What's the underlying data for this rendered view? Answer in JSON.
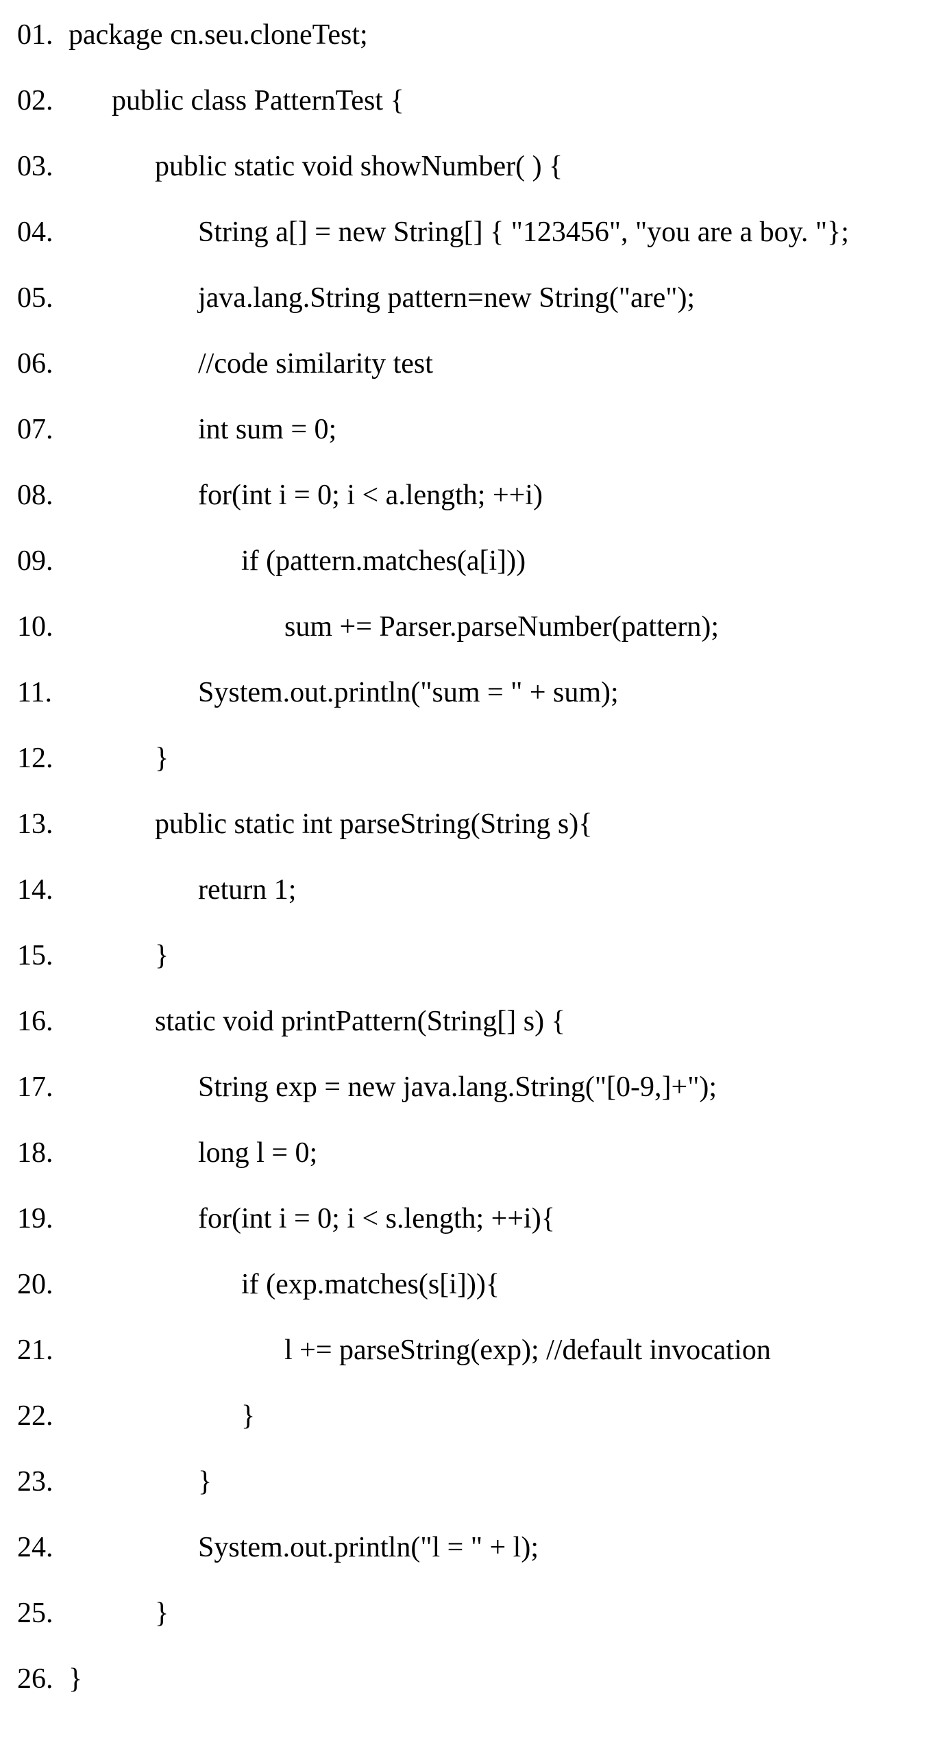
{
  "code": {
    "lines": [
      {
        "num": "01.",
        "indent": 0,
        "text": "package cn.seu.cloneTest;"
      },
      {
        "num": "02.",
        "indent": 1,
        "text": "public class PatternTest {"
      },
      {
        "num": "03.",
        "indent": 2,
        "text": "public static void showNumber( ) {"
      },
      {
        "num": "04.",
        "indent": 3,
        "text": "String a[] = new String[] { \"123456\", \"you are a boy. \"};"
      },
      {
        "num": "05.",
        "indent": 3,
        "text": "java.lang.String pattern=new String(\"are\");"
      },
      {
        "num": "06.",
        "indent": 3,
        "text": "//code similarity test"
      },
      {
        "num": "07.",
        "indent": 3,
        "text": "int sum = 0;"
      },
      {
        "num": "08.",
        "indent": 3,
        "text": "for(int i = 0; i < a.length; ++i)"
      },
      {
        "num": "09.",
        "indent": 4,
        "text": "if (pattern.matches(a[i]))"
      },
      {
        "num": "10.",
        "indent": 5,
        "text": "sum += Parser.parseNumber(pattern);"
      },
      {
        "num": "11.",
        "indent": 3,
        "text": "System.out.println(\"sum = \" + sum);"
      },
      {
        "num": "12.",
        "indent": 2,
        "text": "}"
      },
      {
        "num": "13.",
        "indent": 2,
        "text": "public static int parseString(String s){"
      },
      {
        "num": "14.",
        "indent": 3,
        "text": "return 1;"
      },
      {
        "num": "15.",
        "indent": 2,
        "text": "}"
      },
      {
        "num": "16.",
        "indent": 2,
        "text": "static void printPattern(String[] s) {"
      },
      {
        "num": "17.",
        "indent": 3,
        "text": "String exp = new java.lang.String(\"[0-9,]+\");"
      },
      {
        "num": "18.",
        "indent": 3,
        "text": "long l = 0;"
      },
      {
        "num": "19.",
        "indent": 3,
        "text": "for(int i = 0; i < s.length; ++i){"
      },
      {
        "num": "20.",
        "indent": 4,
        "text": "if (exp.matches(s[i])){"
      },
      {
        "num": "21.",
        "indent": 5,
        "text": "l += parseString(exp); //default invocation"
      },
      {
        "num": "22.",
        "indent": 4,
        "text": "}"
      },
      {
        "num": "23.",
        "indent": 3,
        "text": "}"
      },
      {
        "num": "24.",
        "indent": 3,
        "text": "System.out.println(\"l = \" + l);"
      },
      {
        "num": "25.",
        "indent": 2,
        "text": "}"
      },
      {
        "num": "26.",
        "indent": 0,
        "text": "}"
      }
    ],
    "indentUnit": "      "
  }
}
